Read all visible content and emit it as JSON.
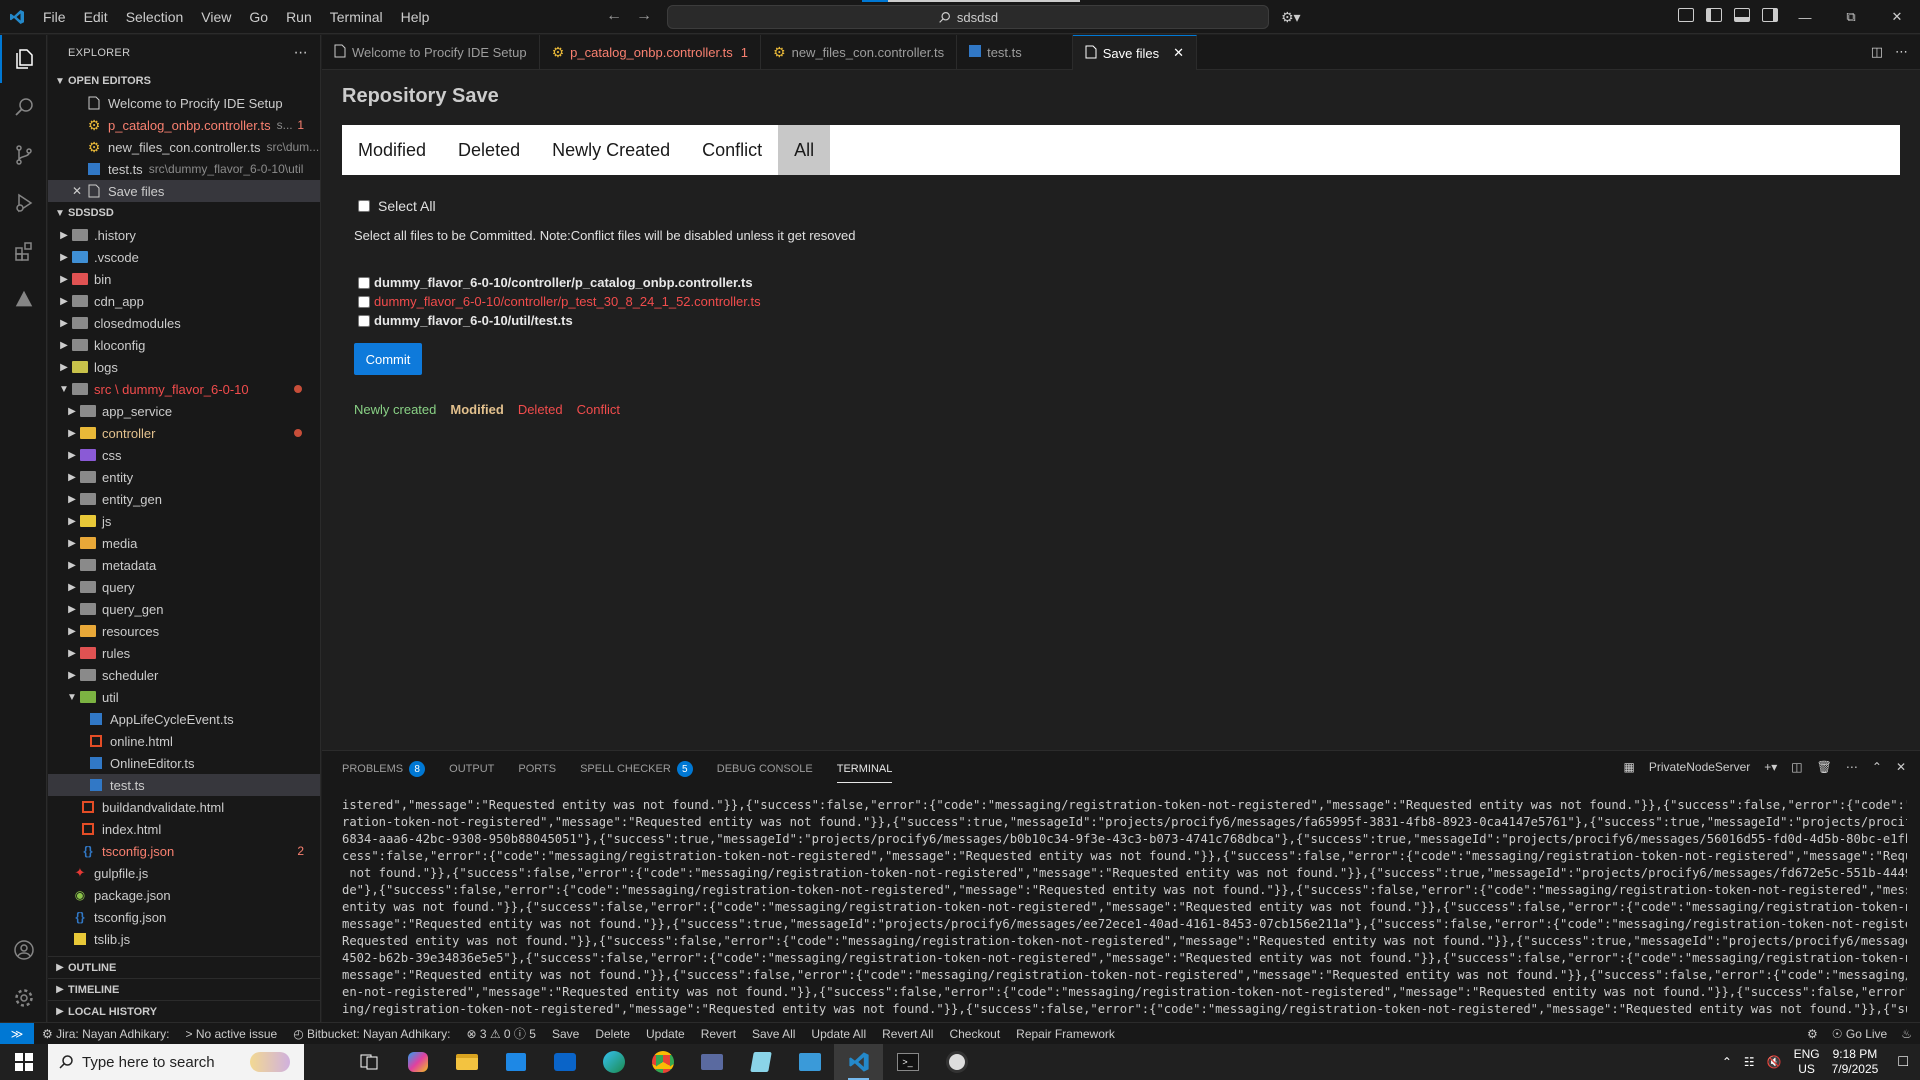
{
  "menu": [
    "File",
    "Edit",
    "Selection",
    "View",
    "Go",
    "Run",
    "Terminal",
    "Help"
  ],
  "search": {
    "text": "sdsdsd"
  },
  "explorer": {
    "title": "EXPLORER",
    "open_editors_label": "OPEN EDITORS",
    "open_editors": [
      {
        "name": "Welcome to Procify IDE Setup",
        "desc": "",
        "badge": ""
      },
      {
        "name": "p_catalog_onbp.controller.ts",
        "desc": "s...",
        "badge": "1"
      },
      {
        "name": "new_files_con.controller.ts",
        "desc": "src\\dum...",
        "badge": ""
      },
      {
        "name": "test.ts",
        "desc": "src\\dummy_flavor_6-0-10\\util",
        "badge": ""
      },
      {
        "name": "Save files",
        "desc": "",
        "badge": ""
      }
    ],
    "workspace_label": "SDSDSD",
    "tree": [
      {
        "name": ".history"
      },
      {
        "name": ".vscode"
      },
      {
        "name": "bin"
      },
      {
        "name": "cdn_app"
      },
      {
        "name": "closedmodules"
      },
      {
        "name": "kloconfig"
      },
      {
        "name": "logs"
      },
      {
        "name": "src \\ dummy_flavor_6-0-10"
      },
      {
        "name": "app_service"
      },
      {
        "name": "controller"
      },
      {
        "name": "css"
      },
      {
        "name": "entity"
      },
      {
        "name": "entity_gen"
      },
      {
        "name": "js"
      },
      {
        "name": "media"
      },
      {
        "name": "metadata"
      },
      {
        "name": "query"
      },
      {
        "name": "query_gen"
      },
      {
        "name": "resources"
      },
      {
        "name": "rules"
      },
      {
        "name": "scheduler"
      },
      {
        "name": "util"
      },
      {
        "name": "AppLifeCycleEvent.ts"
      },
      {
        "name": "online.html"
      },
      {
        "name": "OnlineEditor.ts"
      },
      {
        "name": "test.ts"
      },
      {
        "name": "buildandvalidate.html"
      },
      {
        "name": "index.html"
      },
      {
        "name": "tsconfig.json",
        "badge": "2"
      },
      {
        "name": "gulpfile.js"
      },
      {
        "name": "package.json"
      },
      {
        "name": "tsconfig.json"
      },
      {
        "name": "tslib.js"
      }
    ],
    "bottom_sections": [
      "OUTLINE",
      "TIMELINE",
      "LOCAL HISTORY"
    ]
  },
  "tabs": [
    {
      "label": "Welcome to Procify IDE Setup",
      "badge": ""
    },
    {
      "label": "p_catalog_onbp.controller.ts",
      "badge": "1"
    },
    {
      "label": "new_files_con.controller.ts",
      "badge": ""
    },
    {
      "label": "test.ts",
      "badge": ""
    },
    {
      "label": "Save files",
      "badge": ""
    }
  ],
  "repo": {
    "title": "Repository Save",
    "filters": [
      "Modified",
      "Deleted",
      "Newly Created",
      "Conflict",
      "All"
    ],
    "select_all": "Select All",
    "note": "Select all files to be Committed. Note:Conflict files will be disabled unless it get resoved",
    "files": [
      "dummy_flavor_6-0-10/controller/p_catalog_onbp.controller.ts",
      "dummy_flavor_6-0-10/controller/p_test_30_8_24_1_52.controller.ts",
      "dummy_flavor_6-0-10/util/test.ts"
    ],
    "commit": "Commit",
    "legend": {
      "new": "Newly created",
      "modified": "Modified",
      "deleted": "Deleted",
      "conflict": "Conflict"
    }
  },
  "panel": {
    "tabs": [
      {
        "label": "PROBLEMS",
        "count": "8"
      },
      {
        "label": "OUTPUT",
        "count": ""
      },
      {
        "label": "PORTS",
        "count": ""
      },
      {
        "label": "SPELL CHECKER",
        "count": "5"
      },
      {
        "label": "DEBUG CONSOLE",
        "count": ""
      },
      {
        "label": "TERMINAL",
        "count": ""
      }
    ],
    "terminal_name": "PrivateNodeServer",
    "terminal_lines": [
      "istered\",\"message\":\"Requested entity was not found.\"}},{\"success\":false,\"error\":{\"code\":\"messaging/registration-token-not-registered\",\"message\":\"Requested entity was not found.\"}},{\"success\":false,\"error\":{\"code\":\"messaging",
      "ration-token-not-registered\",\"message\":\"Requested entity was not found.\"}},{\"success\":true,\"messageId\":\"projects/procify6/messages/fa65995f-3831-4fb8-8923-0ca4147e5761\"},{\"success\":true,\"messageId\":\"projects/procify6/messag",
      "6834-aaa6-42bc-9308-950b88045051\"},{\"success\":true,\"messageId\":\"projects/procify6/messages/b0b10c34-9f3e-43c3-b073-4741c768dbca\"},{\"success\":true,\"messageId\":\"projects/procify6/messages/56016d55-fd0d-4d5b-80bc-e1fbae60e3e4\"",
      "cess\":false,\"error\":{\"code\":\"messaging/registration-token-not-registered\",\"message\":\"Requested entity was not found.\"}},{\"success\":false,\"error\":{\"code\":\"messaging/registration-token-not-registered\",\"message\":\"Requested ent",
      " not found.\"}},{\"success\":false,\"error\":{\"code\":\"messaging/registration-token-not-registered\",\"message\":\"Requested entity was not found.\"}},{\"success\":true,\"messageId\":\"projects/procify6/messages/fd672e5c-551b-4449-887b-491",
      "de\"},{\"success\":false,\"error\":{\"code\":\"messaging/registration-token-not-registered\",\"message\":\"Requested entity was not found.\"}},{\"success\":false,\"error\":{\"code\":\"messaging/registration-token-not-registered\",\"message\":\"Req",
      "entity was not found.\"}},{\"success\":false,\"error\":{\"code\":\"messaging/registration-token-not-registered\",\"message\":\"Requested entity was not found.\"}},{\"success\":false,\"error\":{\"code\":\"messaging/registration-token-not-regist",
      "message\":\"Requested entity was not found.\"}},{\"success\":true,\"messageId\":\"projects/procify6/messages/ee72ece1-40ad-4161-8453-07cb156e211a\"},{\"success\":false,\"error\":{\"code\":\"messaging/registration-token-not-registered\",\"mes",
      "Requested entity was not found.\"}},{\"success\":false,\"error\":{\"code\":\"messaging/registration-token-not-registered\",\"message\":\"Requested entity was not found.\"}},{\"success\":true,\"messageId\":\"projects/procify6/messages/1af029e",
      "4502-b62b-39e34836e5e5\"},{\"success\":false,\"error\":{\"code\":\"messaging/registration-token-not-registered\",\"message\":\"Requested entity was not found.\"}},{\"success\":false,\"error\":{\"code\":\"messaging/registration-token-not-regist",
      "message\":\"Requested entity was not found.\"}},{\"success\":false,\"error\":{\"code\":\"messaging/registration-token-not-registered\",\"message\":\"Requested entity was not found.\"}},{\"success\":false,\"error\":{\"code\":\"messaging/registrat",
      "en-not-registered\",\"message\":\"Requested entity was not found.\"}},{\"success\":false,\"error\":{\"code\":\"messaging/registration-token-not-registered\",\"message\":\"Requested entity was not found.\"}},{\"success\":false,\"error\":{\"code\":",
      "ing/registration-token-not-registered\",\"message\":\"Requested entity was not found.\"}},{\"success\":false,\"error\":{\"code\":\"messaging/registration-token-not-registered\",\"message\":\"Requested entity was not found.\"}},{\"success\":fa"
    ]
  },
  "statusbar": {
    "jira": "Jira: Nayan Adhikary:",
    "issue": "No active issue",
    "bitbucket": "Bitbucket: Nayan Adhikary:",
    "problems": "⊗ 3 ⚠ 0 ⓘ 5",
    "actions": [
      "Save",
      "Delete",
      "Update",
      "Revert",
      "Save All",
      "Update All",
      "Revert All",
      "Checkout",
      "Repair Framework"
    ],
    "golive": "Go Live"
  },
  "taskbar": {
    "search_placeholder": "Type here to search",
    "lang1": "ENG",
    "lang2": "US",
    "time": "9:18 PM",
    "date": "7/9/2025"
  }
}
